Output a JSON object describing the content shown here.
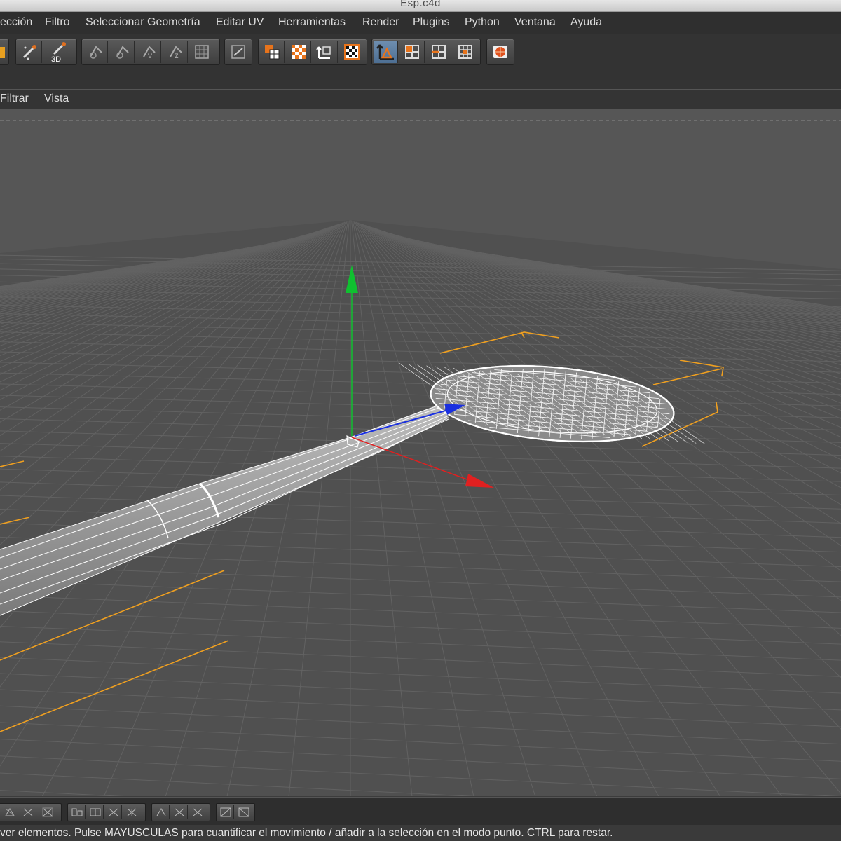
{
  "window": {
    "title": "Esp.c4d"
  },
  "menubar": {
    "items": [
      "ección",
      "Filtro",
      "Seleccionar Geometría",
      "Editar UV",
      "Herramientas",
      "Render",
      "Plugins",
      "Python",
      "Ventana",
      "Ayuda"
    ]
  },
  "viewport_menu": {
    "items": [
      "Filtrar",
      "Vista"
    ]
  },
  "toolbar": {
    "buttons": [
      "paint-brush-tool-icon",
      "sculpt-tool-icon",
      "3d-paint-icon",
      "projection-cube-icon",
      "projection-cylinder-icon",
      "projection-uv-icon",
      "projection-flat-icon",
      "projection-grid-icon",
      "texture-tag-icon",
      "texture-mode-icon",
      "uv-polygon-mode-icon",
      "uv-transform-icon",
      "checker-mode-icon",
      "model-mode-icon",
      "points-mode-icon",
      "edges-mode-icon",
      "polygons-mode-icon",
      "render-view-icon"
    ],
    "active": "model-mode-icon"
  },
  "scene": {
    "objects": [
      "badminton-racket"
    ],
    "axes": {
      "x_color": "#e02020",
      "y_color": "#10c030",
      "z_color": "#1a30e0"
    },
    "selection_color": "#f0a020"
  },
  "bottom_toolbar": {
    "buttons": [
      "align-left-icon",
      "align-center-icon",
      "align-right-icon",
      "distribute-a-icon",
      "distribute-b-icon",
      "distribute-c-icon",
      "distribute-d-icon",
      "mirror-a-icon",
      "mirror-b-icon",
      "mirror-c-icon",
      "snap-a-icon",
      "snap-b-icon"
    ]
  },
  "status": {
    "message": "ver elementos. Pulse MAYUSCULAS para cuantificar el movimiento / añadir a la selección en el modo punto. CTRL para restar."
  }
}
